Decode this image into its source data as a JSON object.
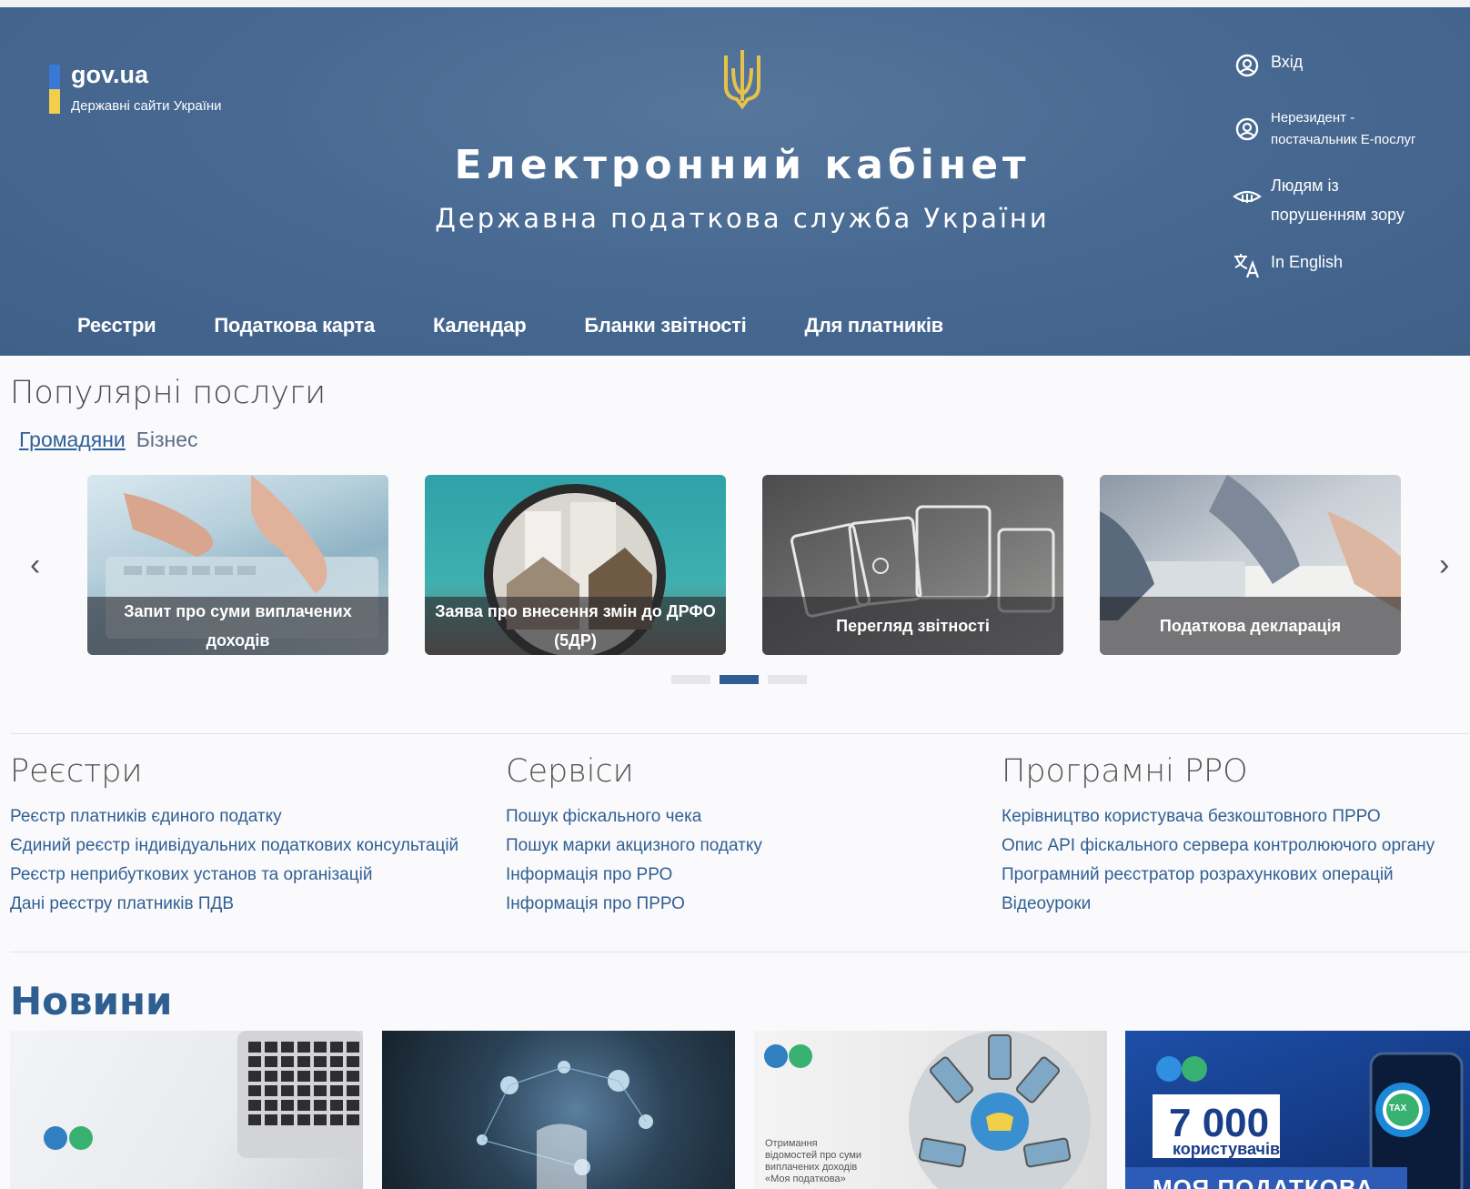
{
  "header": {
    "gov_title": "gov.ua",
    "gov_subtitle": "Державні сайти України",
    "title": "Електронний кабінет",
    "subtitle": "Державна податкова служба України",
    "user_menu": [
      {
        "label": "Вхід",
        "icon": "user-circle-icon"
      },
      {
        "label_line1": "Нерезидент -",
        "label_line2": "постачальник Е-послуг",
        "icon": "user-circle-icon"
      },
      {
        "label_line1": "Людям із",
        "label_line2": "порушенням зору",
        "icon": "eye-icon"
      },
      {
        "label": "In English",
        "icon": "translate-icon"
      }
    ],
    "nav": [
      "Реєстри",
      "Податкова карта",
      "Календар",
      "Бланки звітності",
      "Для платників"
    ]
  },
  "popular": {
    "title": "Популярні послуги",
    "tabs": [
      "Громадяни",
      "Бізнес"
    ],
    "active_tab": "Громадяни",
    "cards": [
      {
        "caption": "Запит про суми виплачених доходів"
      },
      {
        "caption": "Заява про внесення змін до ДРФО (5ДР)"
      },
      {
        "caption": "Перегляд звітності"
      },
      {
        "caption": "Податкова декларація"
      }
    ],
    "carousel_pages": 3,
    "carousel_active": 2
  },
  "sections": [
    {
      "title": "Реєстри",
      "links": [
        "Реєстр платників єдиного податку",
        "Єдиний реєстр індивідуальних податкових консультацій",
        "Реєстр неприбуткових установ та організацій",
        "Дані реєстру платників ПДВ"
      ]
    },
    {
      "title": "Сервіси",
      "links": [
        "Пошук фіскального чека",
        "Пошук марки акцизного податку",
        "Інформація про РРО",
        "Інформація про ПРРО"
      ]
    },
    {
      "title": "Програмні РРО",
      "links": [
        "Керівництво користувача безкоштовного ПРРО",
        "Опис API фіскального сервера контролюючого органу",
        "Програмний реєстратор розрахункових операцій",
        "Відеоуроки"
      ]
    }
  ],
  "news": {
    "title": "Новини",
    "logo_text": "Державна податкова служба України",
    "card3_text_l1": "Отримання",
    "card3_text_l2": "відомостей про суми",
    "card3_text_l3": "виплачених доходів",
    "card3_text_l4": "«Моя податкова»",
    "card4_number": "7 000",
    "card4_label": "користувачів",
    "card4_banner": "МОЯ ПОДАТКОВА",
    "card4_tax": "TAX"
  },
  "colors": {
    "header_bg": "#486a92",
    "accent": "#2f5e94",
    "link": "#315f93",
    "gov_blue": "#3a78d6",
    "gov_yellow": "#f1cf4a"
  }
}
